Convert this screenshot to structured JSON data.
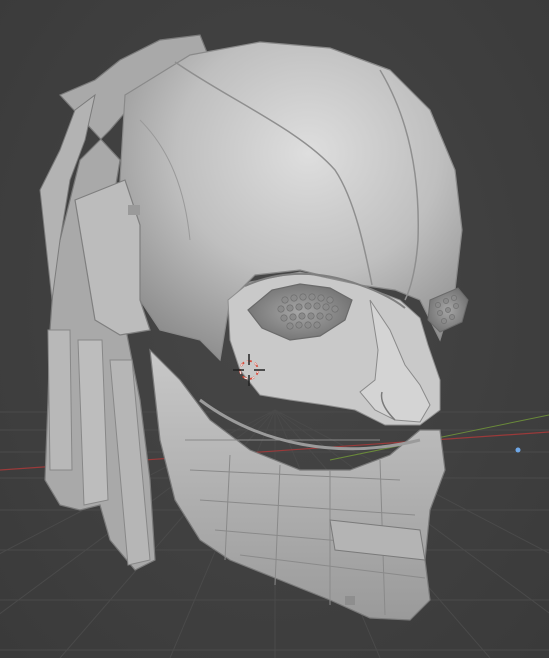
{
  "viewport": {
    "background_color": "#3d3d3d",
    "grid_color": "#4a4a4a",
    "x_axis_color": "#9a3a3a",
    "y_axis_color": "#6a8a3a",
    "mesh_color": "#c4c4c4"
  },
  "scene": {
    "object": "sculpted-cyborg-head-mesh",
    "cursor_icon": "3d-cursor-icon",
    "light_icon": "light-point-icon"
  }
}
